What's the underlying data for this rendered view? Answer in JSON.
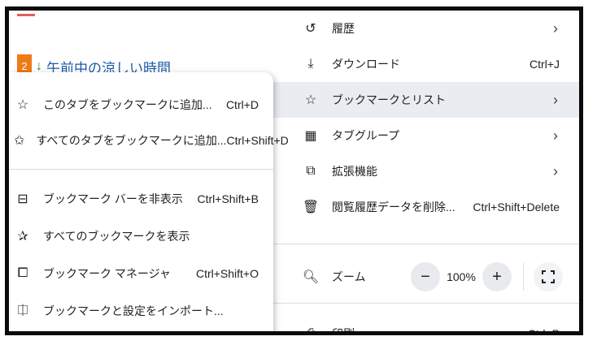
{
  "background_page": {
    "item_number": "2",
    "item_arrow": "↓",
    "item_title": "午前中の涼しい時間"
  },
  "main_menu": {
    "items": [
      {
        "label": "履歴",
        "icon": "history-icon"
      },
      {
        "label": "ダウンロード",
        "icon": "download-icon",
        "shortcut": "Ctrl+J"
      },
      {
        "label": "ブックマークとリスト",
        "icon": "star-icon"
      },
      {
        "label": "タブグループ",
        "icon": "tab-groups-icon"
      },
      {
        "label": "拡張機能",
        "icon": "extension-icon"
      },
      {
        "label": "閲覧履歴データを削除...",
        "icon": "trash-icon",
        "shortcut": "Ctrl+Shift+Delete"
      },
      {
        "label": "ズーム",
        "icon": "zoom-icon"
      },
      {
        "label": "印刷...",
        "icon": "print-icon",
        "shortcut": "Ctrl+P"
      }
    ],
    "zoom": {
      "minus": "−",
      "value": "100%",
      "plus": "+"
    }
  },
  "bookmark_submenu": {
    "items": [
      {
        "label": "このタブをブックマークに追加...",
        "icon": "star-outline-icon",
        "shortcut": "Ctrl+D"
      },
      {
        "label": "すべてのタブをブックマークに追加...",
        "icon": "star-multiple-icon",
        "shortcut": "Ctrl+Shift+D"
      },
      {
        "label": "ブックマーク バーを非表示",
        "icon": "bookmark-bar-icon",
        "shortcut": "Ctrl+Shift+B"
      },
      {
        "label": "すべてのブックマークを表示",
        "icon": "all-bookmarks-icon"
      },
      {
        "label": "ブックマーク マネージャ",
        "icon": "bookmark-manager-icon",
        "shortcut": "Ctrl+Shift+O"
      },
      {
        "label": "ブックマークと設定をインポート...",
        "icon": "import-icon"
      }
    ]
  },
  "colors": {
    "highlight": "#e9ecf1",
    "frame": "#0b0b0b",
    "accent_orange": "#ee7b16",
    "link_blue": "#1a5aa8"
  }
}
